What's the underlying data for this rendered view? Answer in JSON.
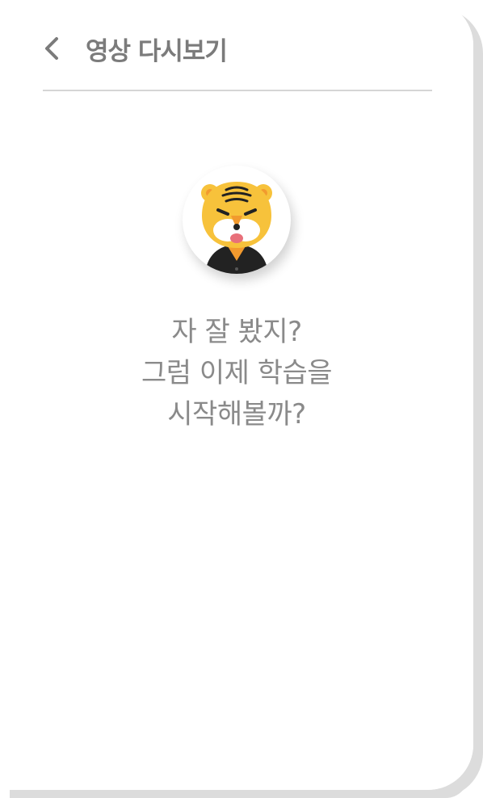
{
  "header": {
    "title": "영상 다시보기",
    "back_icon": "chevron-left-icon"
  },
  "avatar": {
    "icon": "tiger-mascot-icon"
  },
  "message": {
    "line1": "자 잘 봤지?",
    "line2": "그럼 이제 학습을",
    "line3": "시작해볼까?"
  },
  "colors": {
    "title_text": "#7b7b7b",
    "message_text": "#8a8a8a",
    "divider": "#d5d5d5",
    "card_shadow": "#dcdcdc",
    "tiger_yellow": "#f7c23b",
    "tiger_orange": "#f29a2e"
  }
}
